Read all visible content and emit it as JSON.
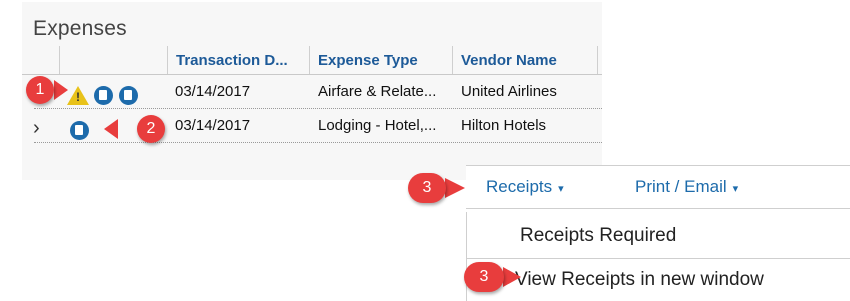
{
  "expenses": {
    "title": "Expenses",
    "columns": [
      "Transaction D...",
      "Expense Type",
      "Vendor Name"
    ],
    "rows": [
      {
        "date": "03/14/2017",
        "expense_type": "Airfare & Relate...",
        "vendor": "United Airlines"
      },
      {
        "date": "03/14/2017",
        "expense_type": "Lodging - Hotel,...",
        "vendor": "Hilton Hotels"
      }
    ]
  },
  "annotations": {
    "badge1": "1",
    "badge2": "2",
    "badge3a": "3",
    "badge3b": "3"
  },
  "menu": {
    "receipts_label": "Receipts",
    "print_email_label": "Print / Email",
    "caret": "▾"
  },
  "receipts_dropdown": {
    "items": [
      "Receipts Required",
      "View Receipts in new window"
    ]
  },
  "icons": {
    "warning": "warning-triangle-icon",
    "receipt": "receipt-icon",
    "receipt_required": "receipt-required-icon",
    "expand": "chevron-right-icon"
  },
  "colors": {
    "link_blue": "#1d6bab",
    "header_blue": "#1d5a98",
    "badge_red": "#e83d3d",
    "warning_yellow": "#e8c21a"
  }
}
